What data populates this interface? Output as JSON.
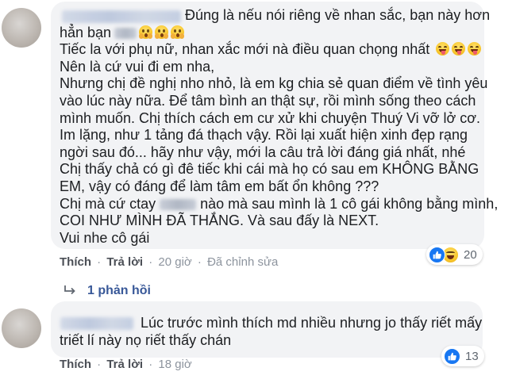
{
  "comments": [
    {
      "lines": [
        [
          "Đúng là nếu nói riêng về nhan sắc, bạn này hơn"
        ],
        [
          "hẳn bạn"
        ],
        [
          "Tiếc la với phụ nữ, nhan xắc mới nà điều quan chọng nhất"
        ],
        [
          "Nên là cứ vui đi em nha,"
        ],
        [
          "Nhưng chị đề nghị nho nhỏ, là em kg chia sẻ quan điểm về tình yêu"
        ],
        [
          "vào lúc này nữa. Để tâm bình an thật sự, rồi mình sống theo cách"
        ],
        [
          "mình muốn. Chị thích cách em cư xử khi chuyện Thuý Vi vỡ lở cơ."
        ],
        [
          "Im lặng, như 1 tảng đá thạch vậy. Rồi lại xuất hiện xinh đẹp rạng"
        ],
        [
          "ngời sau đó... hãy như vậy, mới la câu trả lời đáng giá nhất, nhé"
        ],
        [
          "Chị thấy chả có gì đê tiếc khi cái mà họ có sau em KHÔNG BẰNG"
        ],
        [
          "EM, vậy có đáng để làm tâm em bất ổn không ???"
        ],
        [
          "Chị mà cứ ctay",
          "nào mà sau mình là 1 cô gái không bằng mình,"
        ],
        [
          "COI NHƯ MÌNH ĐÃ THẮNG. Và sau đấy là NEXT."
        ],
        [
          "Vui nhe cô gái"
        ]
      ],
      "actions": {
        "like": "Thích",
        "reply": "Trả lời",
        "time": "20 giờ",
        "edited": "Đã chỉnh sửa",
        "separator": "·"
      },
      "reactions": {
        "count": "20",
        "types": [
          "like",
          "haha"
        ]
      },
      "replies_label": "1 phản hồi"
    },
    {
      "lines": [
        [
          "Lúc trước mình thích md nhiều nhưng jo thấy riết mấy"
        ],
        [
          "triết lí này nọ riết thấy chán"
        ]
      ],
      "actions": {
        "like": "Thích",
        "reply": "Trả lời",
        "time": "18 giờ",
        "separator": "·"
      },
      "reactions": {
        "count": "13",
        "types": [
          "like"
        ]
      }
    }
  ],
  "colors": {
    "bubble": "#f2f3f5",
    "meta": "#8d949e",
    "link": "#385898",
    "like_blue": "#1877f2"
  }
}
